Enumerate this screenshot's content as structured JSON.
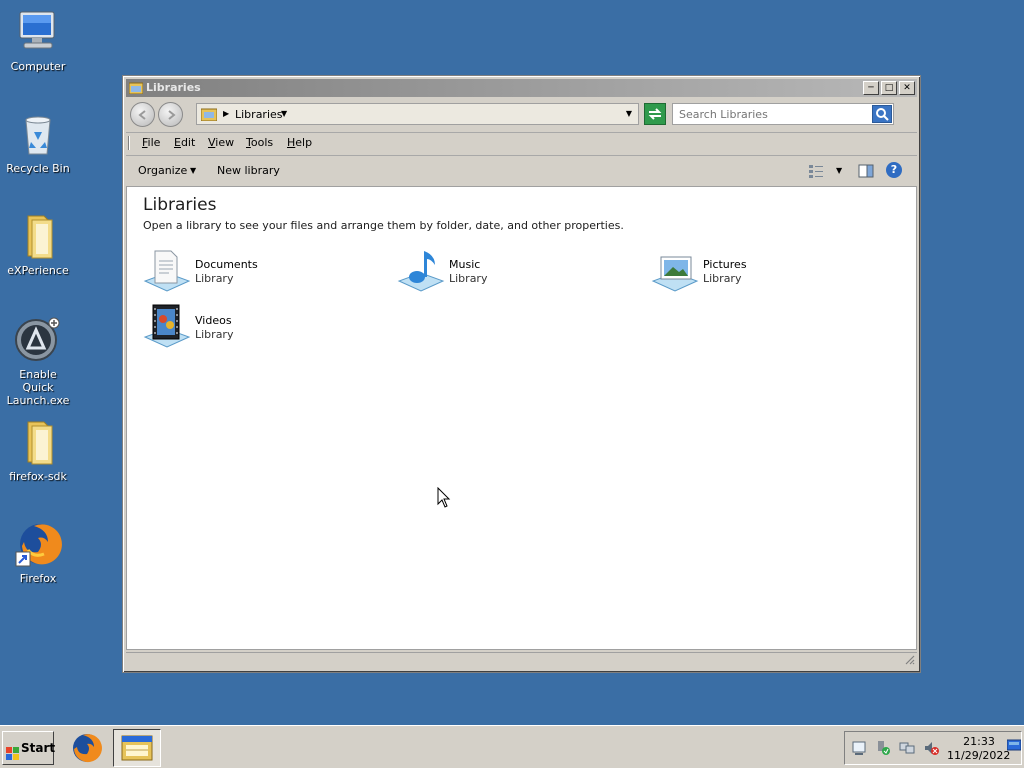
{
  "desktop": {
    "icons": [
      {
        "label": "Computer",
        "icon": "computer-icon"
      },
      {
        "label": "Recycle Bin",
        "icon": "recycle-bin-icon"
      },
      {
        "label": "eXPerience",
        "icon": "folder-icon"
      },
      {
        "label": "Enable Quick Launch.exe",
        "icon": "quick-launch-icon"
      },
      {
        "label": "firefox-sdk",
        "icon": "folder-icon"
      },
      {
        "label": "Firefox",
        "icon": "firefox-icon"
      }
    ]
  },
  "window": {
    "title": "Libraries",
    "address": {
      "crumb": "Libraries"
    },
    "search": {
      "placeholder": "Search Libraries"
    },
    "menu": [
      "File",
      "Edit",
      "View",
      "Tools",
      "Help"
    ],
    "commands": {
      "organize": "Organize",
      "new_library": "New library"
    },
    "heading": "Libraries",
    "subtitle": "Open a library to see your files and arrange them by folder, date, and other properties.",
    "libraries": [
      {
        "name": "Documents",
        "type": "Library",
        "icon": "documents-library-icon"
      },
      {
        "name": "Music",
        "type": "Library",
        "icon": "music-library-icon"
      },
      {
        "name": "Pictures",
        "type": "Library",
        "icon": "pictures-library-icon"
      },
      {
        "name": "Videos",
        "type": "Library",
        "icon": "videos-library-icon"
      }
    ]
  },
  "taskbar": {
    "start_label": "Start",
    "clock": {
      "time": "21:33",
      "date": "11/29/2022"
    }
  },
  "colors": {
    "desktop": "#3a6ea5",
    "chrome": "#d4d0c8",
    "title_gradient_start": "#808080"
  }
}
